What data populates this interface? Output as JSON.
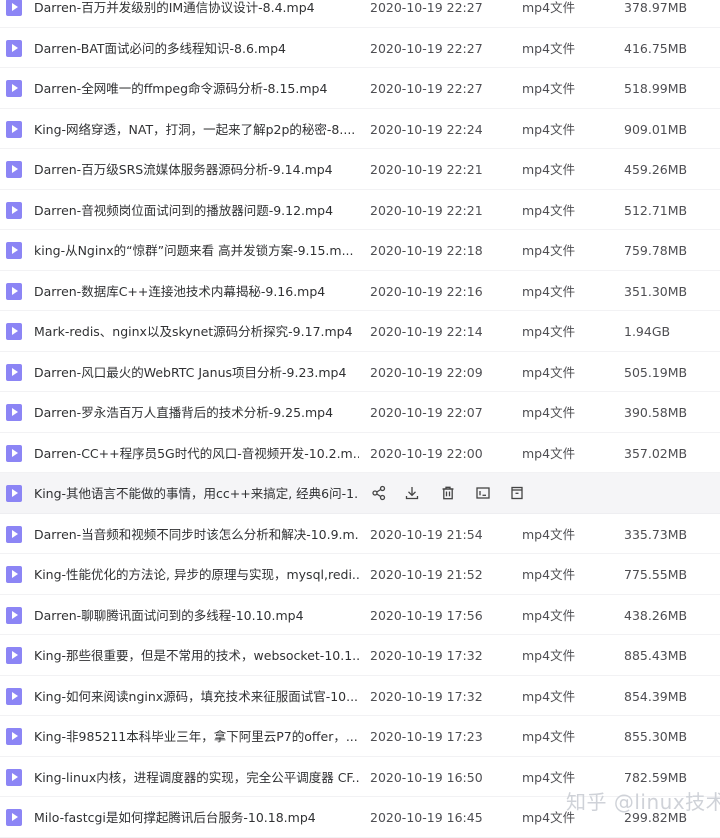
{
  "files": [
    {
      "name": "Darren-百万并发级别的IM通信协议设计-8.4.mp4",
      "date": "2020-10-19 22:27",
      "type": "mp4文件",
      "size": "378.97MB"
    },
    {
      "name": "Darren-BAT面试必问的多线程知识-8.6.mp4",
      "date": "2020-10-19 22:27",
      "type": "mp4文件",
      "size": "416.75MB"
    },
    {
      "name": "Darren-全网唯一的ffmpeg命令源码分析-8.15.mp4",
      "date": "2020-10-19 22:27",
      "type": "mp4文件",
      "size": "518.99MB"
    },
    {
      "name": "King-网络穿透，NAT，打洞，一起来了解p2p的秘密-8....",
      "date": "2020-10-19 22:24",
      "type": "mp4文件",
      "size": "909.01MB"
    },
    {
      "name": "Darren-百万级SRS流媒体服务器源码分析-9.14.mp4",
      "date": "2020-10-19 22:21",
      "type": "mp4文件",
      "size": "459.26MB"
    },
    {
      "name": "Darren-音视频岗位面试问到的播放器问题-9.12.mp4",
      "date": "2020-10-19 22:21",
      "type": "mp4文件",
      "size": "512.71MB"
    },
    {
      "name": "king-从Nginx的“惊群”问题来看 高并发锁方案-9.15.m...",
      "date": "2020-10-19 22:18",
      "type": "mp4文件",
      "size": "759.78MB"
    },
    {
      "name": "Darren-数据库C++连接池技术内幕揭秘-9.16.mp4",
      "date": "2020-10-19 22:16",
      "type": "mp4文件",
      "size": "351.30MB"
    },
    {
      "name": "Mark-redis、nginx以及skynet源码分析探究-9.17.mp4",
      "date": "2020-10-19 22:14",
      "type": "mp4文件",
      "size": "1.94GB"
    },
    {
      "name": "Darren-风口最火的WebRTC Janus项目分析-9.23.mp4",
      "date": "2020-10-19 22:09",
      "type": "mp4文件",
      "size": "505.19MB"
    },
    {
      "name": "Darren-罗永浩百万人直播背后的技术分析-9.25.mp4",
      "date": "2020-10-19 22:07",
      "type": "mp4文件",
      "size": "390.58MB"
    },
    {
      "name": "Darren-CC++程序员5G时代的风口-音视频开发-10.2.m...",
      "date": "2020-10-19 22:00",
      "type": "mp4文件",
      "size": "357.02MB"
    },
    {
      "name": "King-其他语言不能做的事情，用cc++来搞定, 经典6问-1...",
      "date": "",
      "type": "",
      "size": "",
      "hovered": true
    },
    {
      "name": "Darren-当音频和视频不同步时该怎么分析和解决-10.9.m...",
      "date": "2020-10-19 21:54",
      "type": "mp4文件",
      "size": "335.73MB"
    },
    {
      "name": "King-性能优化的方法论, 异步的原理与实现，mysql,redi...",
      "date": "2020-10-19 21:52",
      "type": "mp4文件",
      "size": "775.55MB"
    },
    {
      "name": "Darren-聊聊腾讯面试问到的多线程-10.10.mp4",
      "date": "2020-10-19 17:56",
      "type": "mp4文件",
      "size": "438.26MB"
    },
    {
      "name": "King-那些很重要，但是不常用的技术，websocket-10.1...",
      "date": "2020-10-19 17:32",
      "type": "mp4文件",
      "size": "885.43MB"
    },
    {
      "name": "King-如何来阅读nginx源码，填充技术来征服面试官-10....",
      "date": "2020-10-19 17:32",
      "type": "mp4文件",
      "size": "854.39MB"
    },
    {
      "name": "King-非985211本科毕业三年，拿下阿里云P7的offer，...",
      "date": "2020-10-19 17:23",
      "type": "mp4文件",
      "size": "855.30MB"
    },
    {
      "name": "King-linux内核，进程调度器的实现，完全公平调度器 CF...",
      "date": "2020-10-19 16:50",
      "type": "mp4文件",
      "size": "782.59MB"
    },
    {
      "name": "Milo-fastcgi是如何撑起腾讯后台服务-10.18.mp4",
      "date": "2020-10-19 16:45",
      "type": "mp4文件",
      "size": "299.82MB"
    }
  ],
  "watermark": "知乎 @linux技术栈",
  "icons": {
    "file": "video-file-icon",
    "actions": [
      "share-icon",
      "download-icon",
      "delete-icon",
      "rename-icon",
      "more-icon"
    ]
  },
  "colors": {
    "file_icon": "#8c85f5",
    "hover_row": "#f5f5f7",
    "text": "#303133",
    "watermark": "#cfd2d8"
  }
}
